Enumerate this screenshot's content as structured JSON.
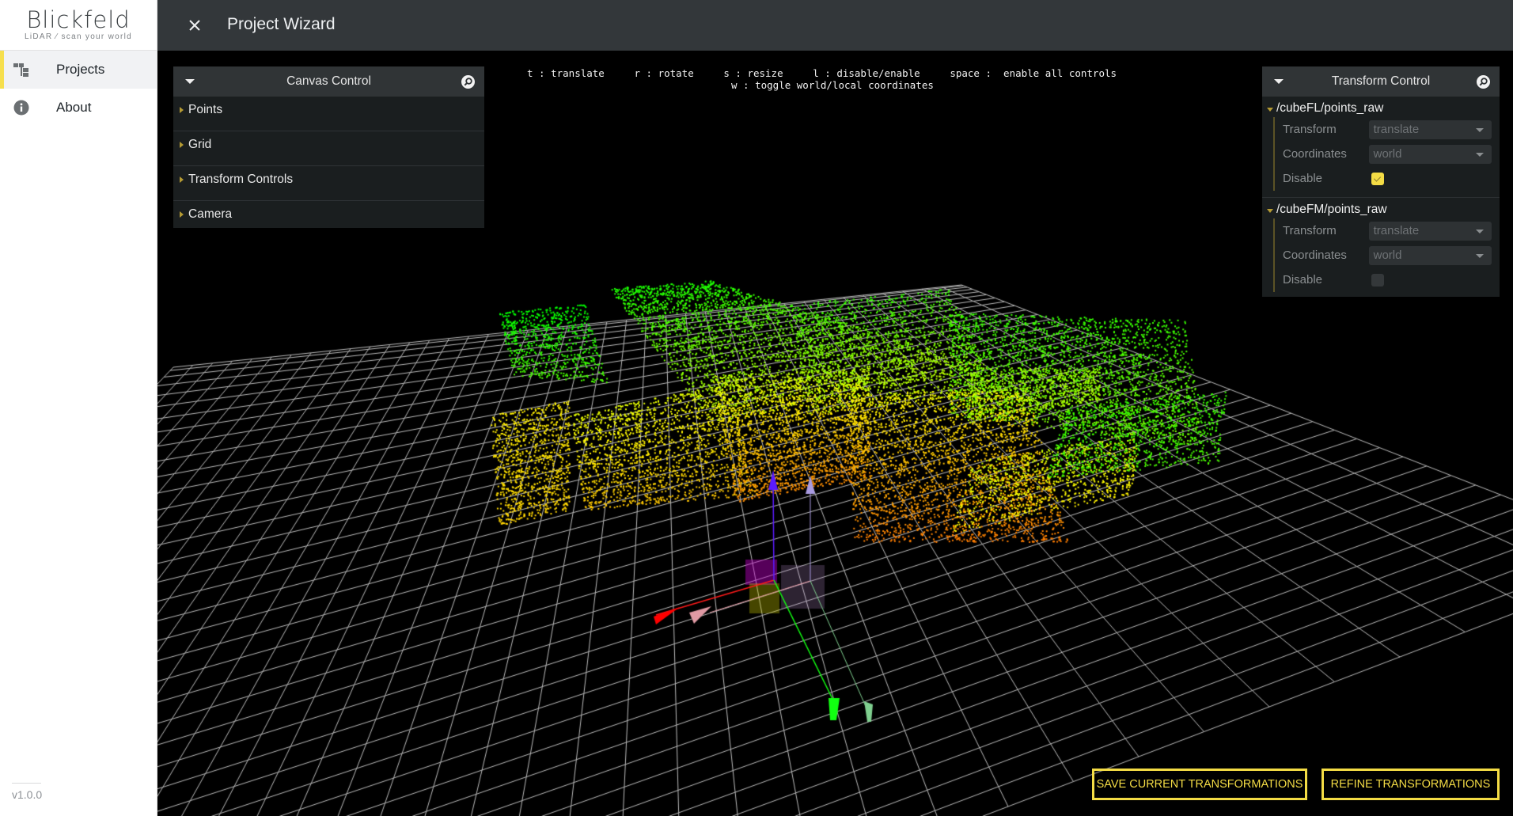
{
  "sidebar": {
    "logo": {
      "brand": "Blickfeld",
      "tagline": "LiDAR ⁄ scan your world"
    },
    "items": [
      {
        "label": "Projects",
        "icon": "tree-structure-icon",
        "active": true
      },
      {
        "label": "About",
        "icon": "info-icon",
        "active": false
      }
    ],
    "version": "v1.0.0"
  },
  "header": {
    "close_icon": "close-icon",
    "title": "Project Wizard"
  },
  "hints": {
    "line1": "t : translate     r : rotate     s : resize     l : disable/enable     space :  enable all controls",
    "line2": "w : toggle world/local coordinates"
  },
  "canvas_control": {
    "title": "Canvas Control",
    "items": [
      {
        "label": "Points"
      },
      {
        "label": "Grid"
      },
      {
        "label": "Transform Controls"
      },
      {
        "label": "Camera"
      }
    ]
  },
  "transform_control": {
    "title": "Transform Control",
    "groups": [
      {
        "name": "/cubeFL/points_raw",
        "transform_label": "Transform",
        "transform_value": "translate",
        "coordinates_label": "Coordinates",
        "coordinates_value": "world",
        "disable_label": "Disable",
        "disabled": true
      },
      {
        "name": "/cubeFM/points_raw",
        "transform_label": "Transform",
        "transform_value": "translate",
        "coordinates_label": "Coordinates",
        "coordinates_value": "world",
        "disable_label": "Disable",
        "disabled": false
      }
    ]
  },
  "actions": {
    "save_label": "SAVE CURRENT TRANSFORMATIONS",
    "refine_label": "REFINE TRANSFORMATIONS"
  },
  "colors": {
    "accent": "#f4dc45",
    "header_bg": "#33373a",
    "panel_bg": "#1a1e1f",
    "axis_x": "#ff0000",
    "axis_y": "#00ff00",
    "axis_z": "#5b1bff"
  }
}
